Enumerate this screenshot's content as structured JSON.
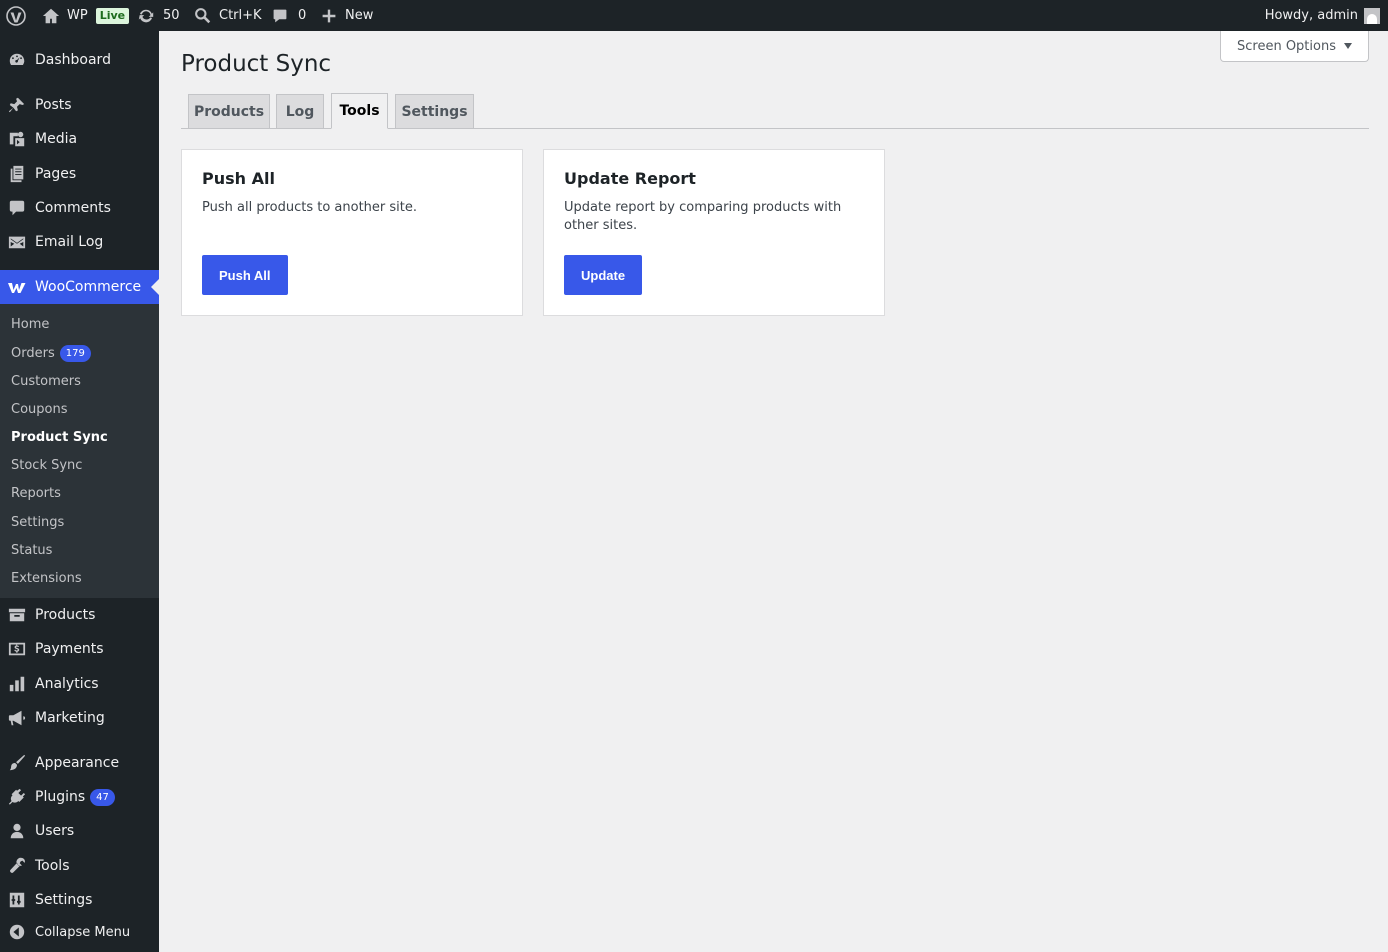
{
  "admin_bar": {
    "site_name": "WP",
    "live_label": "Live",
    "updates_count": "50",
    "search_label": "Ctrl+K",
    "comments_count": "0",
    "new_label": "New",
    "howdy": "Howdy, admin"
  },
  "sidebar": {
    "dashboard": "Dashboard",
    "posts": "Posts",
    "media": "Media",
    "pages": "Pages",
    "comments": "Comments",
    "email_log": "Email Log",
    "woocommerce": "WooCommerce",
    "woo_submenu": {
      "home": "Home",
      "orders": "Orders",
      "orders_count": "179",
      "customers": "Customers",
      "coupons": "Coupons",
      "product_sync": "Product Sync",
      "stock_sync": "Stock Sync",
      "reports": "Reports",
      "settings": "Settings",
      "status": "Status",
      "extensions": "Extensions"
    },
    "products": "Products",
    "payments": "Payments",
    "analytics": "Analytics",
    "marketing": "Marketing",
    "appearance": "Appearance",
    "plugins": "Plugins",
    "plugins_count": "47",
    "users": "Users",
    "tools": "Tools",
    "settings": "Settings",
    "collapse": "Collapse Menu"
  },
  "main": {
    "screen_options": "Screen Options",
    "title": "Product Sync",
    "tabs": [
      {
        "label": "Products"
      },
      {
        "label": "Log"
      },
      {
        "label": "Tools"
      },
      {
        "label": "Settings"
      }
    ],
    "active_tab": "Tools",
    "cards": [
      {
        "title": "Push All",
        "description": "Push all products to another site.",
        "button": "Push All"
      },
      {
        "title": "Update Report",
        "description": "Update report by comparing products with other sites.",
        "button": "Update"
      }
    ]
  },
  "colors": {
    "accent": "#3858e9",
    "admin_dark": "#1d2327",
    "submenu_bg": "#2c3338",
    "page_bg": "#f0f0f1"
  }
}
